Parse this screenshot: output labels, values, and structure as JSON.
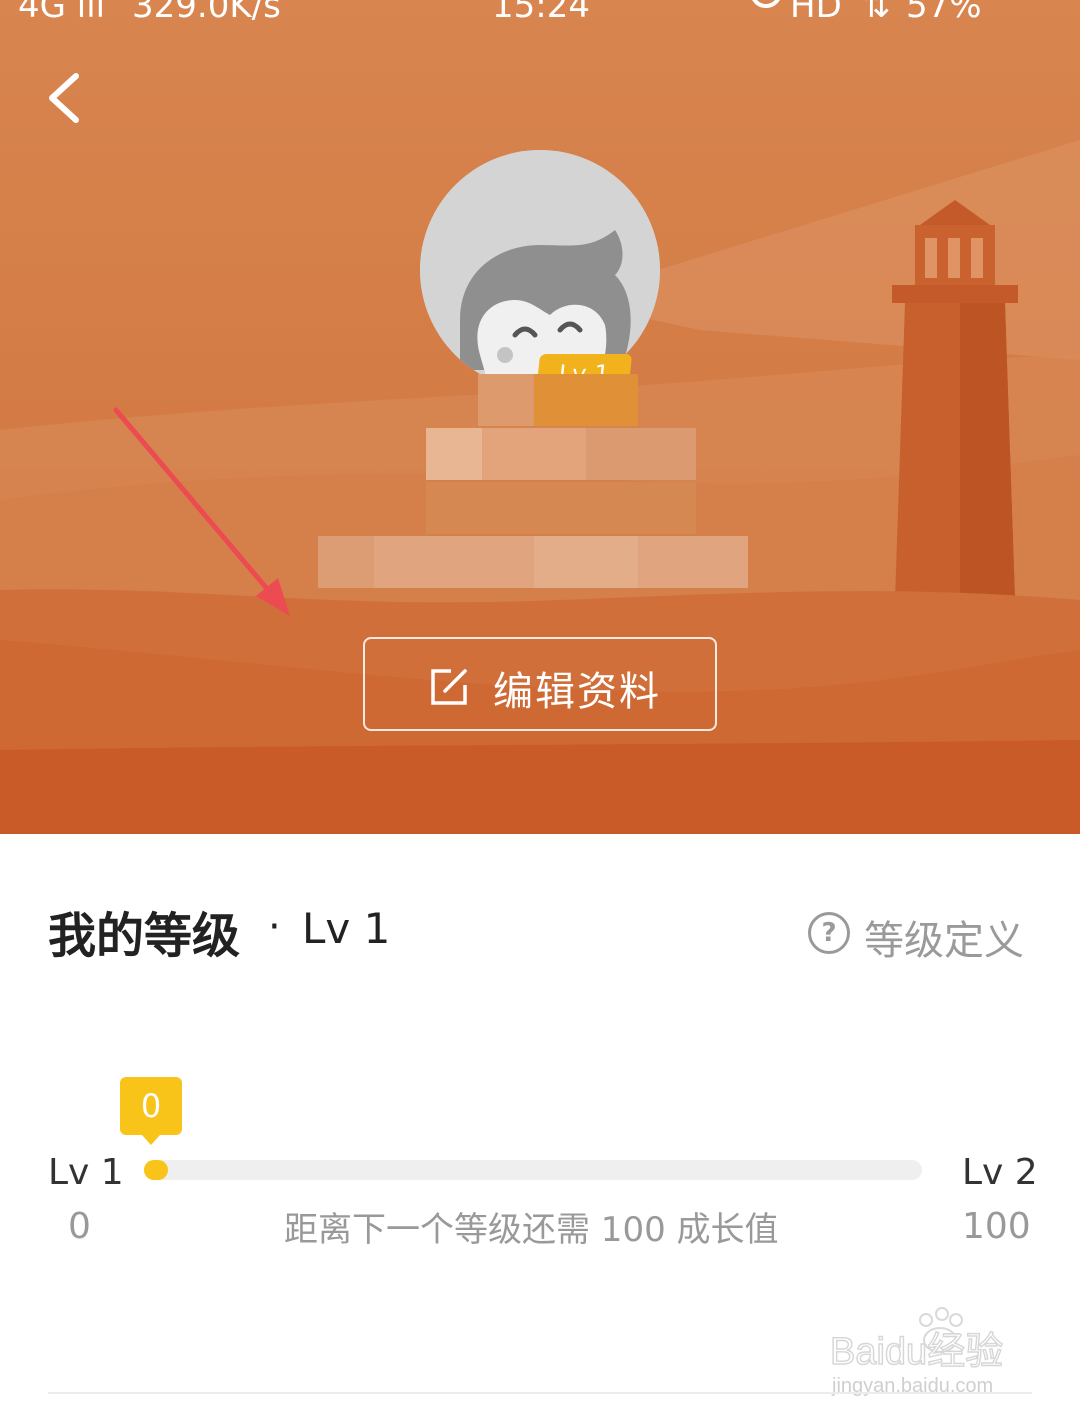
{
  "status_bar": {
    "signal": "4G ıll",
    "net_speed": "329.0K/s",
    "time": "15:24",
    "hd": "HD",
    "wifi": "⇅",
    "battery": "57%"
  },
  "header": {
    "avatar_level_badge": "Lv 1",
    "edit_profile_label": "编辑资料"
  },
  "level_section": {
    "title": "我的等级",
    "separator": "·",
    "current_level": "Lv 1",
    "definition_label": "等级定义",
    "help_glyph": "?",
    "progress": {
      "current_value": "0",
      "start_level": "Lv 1",
      "end_level": "Lv 2",
      "start_value": "0",
      "end_value": "100",
      "fraction": 0,
      "remaining_text": "距离下一个等级还需 100 成长值"
    }
  },
  "watermark": {
    "brand": "Baidu经验",
    "url": "jingyan.baidu.com"
  },
  "colors": {
    "hero_orange": "#d37a44",
    "accent_yellow": "#f8c41a",
    "annotation_red": "#ec4b52"
  },
  "icons": {
    "back": "chevron-left-icon",
    "edit": "edit-icon",
    "help": "question-circle-icon"
  }
}
